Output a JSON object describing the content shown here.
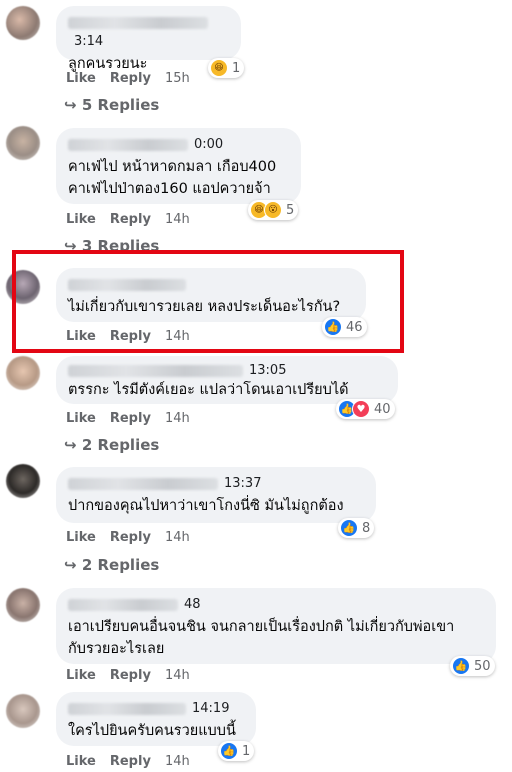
{
  "actions": {
    "like": "Like",
    "reply": "Reply"
  },
  "comments": [
    {
      "time": "3:14",
      "text": "ลูกคนรวยนะ",
      "age": "15h",
      "reaction_count": "1",
      "replies": "5 Replies"
    },
    {
      "time": "0:00",
      "text": "คาเฟ่ไป หน้าหาดกมลา เกือบ400\nคาเฟ่ไปป่าตอง160 แอปควายจ้า",
      "age": "14h",
      "reaction_count": "5",
      "replies": "3 Replies"
    },
    {
      "time": "",
      "text": "ไม่เกี่ยวกับเขารวยเลย หลงประเด็นอะไรกัน?",
      "age": "14h",
      "reaction_count": "46"
    },
    {
      "time": "13:05",
      "text": "ตรรกะ      ไรมีตังค์เยอะ แปลว่าโดนเอาเปรียบได้",
      "age": "14h",
      "reaction_count": "40",
      "replies": "2 Replies"
    },
    {
      "time": "13:37",
      "text": "ปากของคุณไปหาว่าเขาโกงนี่ซิ มันไม่ถูกต้อง",
      "age": "14h",
      "reaction_count": "8",
      "replies": "2 Replies"
    },
    {
      "time": "48",
      "text": "เอาเปรียบคนอื่นจนชิน จนกลายเป็นเรื่องปกติ ไม่เกี่ยวกับพ่อเขา\nกับรวยอะไรเลย",
      "age": "14h",
      "reaction_count": "50"
    },
    {
      "time": "14:19",
      "text": "ใครไปยินครับคนรวยแบบนี้",
      "age": "14h",
      "reaction_count": "1"
    }
  ]
}
